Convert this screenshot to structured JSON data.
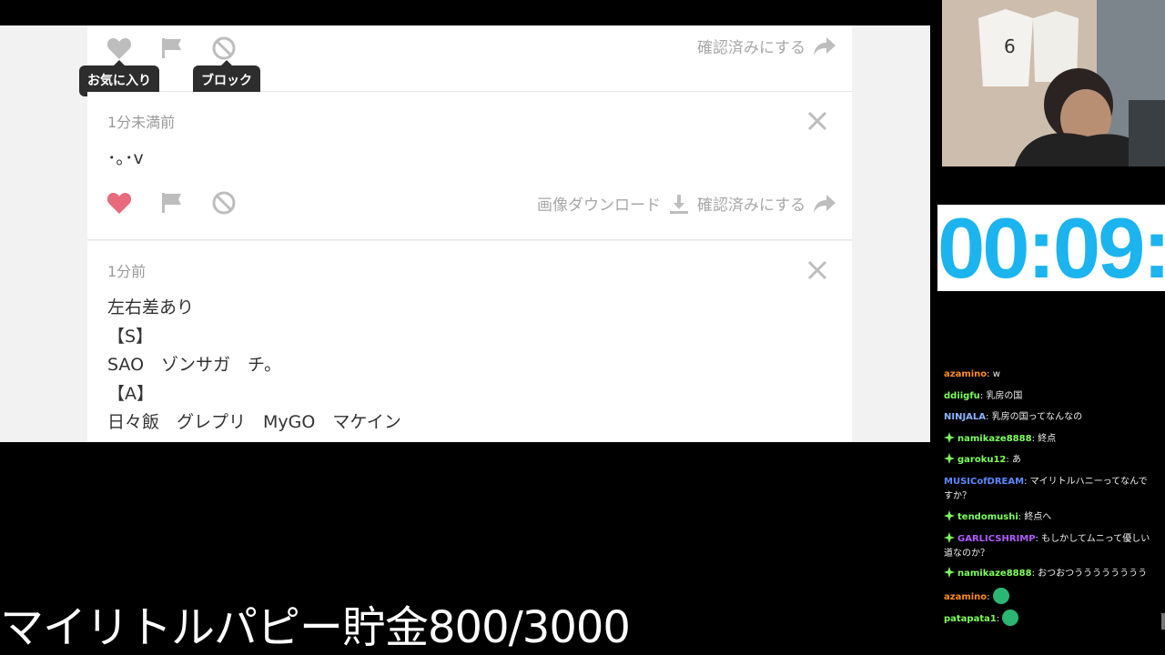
{
  "tooltips": {
    "favorite": "お気に入り",
    "block": "ブロック"
  },
  "cards": [
    {
      "mark_checked": "確認済みにする"
    },
    {
      "time": "1分未満前",
      "text": "･｡･v",
      "download": "画像ダウンロード",
      "mark_checked": "確認済みにする",
      "liked": true
    },
    {
      "time": "1分前",
      "lines": [
        "左右差あり",
        "【S】",
        "SAO　ゾンサガ　チ。",
        "【A】",
        "日々飯　グレプリ　MyGO　マケイン"
      ]
    }
  ],
  "timer": "00:09:",
  "chat": [
    {
      "user": "azamino",
      "color": "#ff8c1a",
      "badge": false,
      "text": "w"
    },
    {
      "user": "ddiigfu",
      "color": "#7dff5a",
      "badge": false,
      "text": "乳房の国"
    },
    {
      "user": "NINJALA",
      "color": "#8ab4ff",
      "badge": false,
      "text": "乳房の国ってなんなの"
    },
    {
      "user": "namikaze8888",
      "color": "#7dff5a",
      "badge": true,
      "text": "終点"
    },
    {
      "user": "garoku12",
      "color": "#7dff5a",
      "badge": true,
      "text": "あ"
    },
    {
      "user": "MUSICofDREAM",
      "color": "#5a8bff",
      "badge": false,
      "text": "マイリトルハニーってなんですか？"
    },
    {
      "user": "tendomushi",
      "color": "#7dff5a",
      "badge": true,
      "text": "終点へ"
    },
    {
      "user": "GARLICSHRIMP",
      "color": "#b05aff",
      "badge": true,
      "text": "もしかしてムニって優しい道なのか？"
    },
    {
      "user": "namikaze8888",
      "color": "#7dff5a",
      "badge": true,
      "text": "おつおつうううううううう"
    },
    {
      "user": "azamino",
      "color": "#ff8c1a",
      "badge": false,
      "text": "",
      "emote": true
    },
    {
      "user": "patapata1",
      "color": "#7dff5a",
      "badge": false,
      "text": "",
      "emote": true
    }
  ],
  "banner": "マイリトルパピー貯金800/3000",
  "colors": {
    "timer": "#1cb4ef",
    "heart_liked": "#e86a7c",
    "icon_gray": "#bdbdbd"
  }
}
